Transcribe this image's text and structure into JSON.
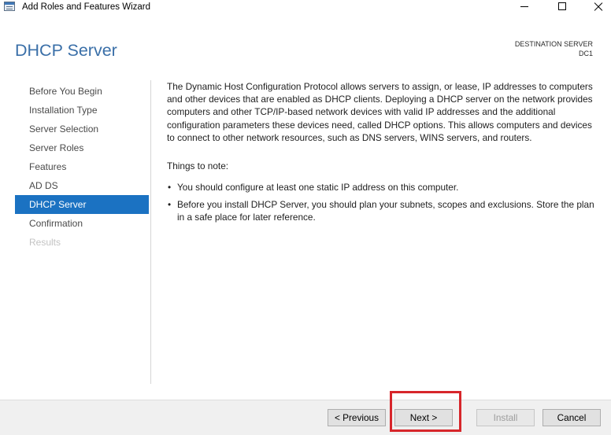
{
  "window": {
    "title": "Add Roles and Features Wizard",
    "app_icon": "server-manager-icon",
    "controls": {
      "minimize": "minimize-icon",
      "maximize": "maximize-icon",
      "close": "close-icon"
    }
  },
  "header": {
    "title": "DHCP Server",
    "destination_label": "DESTINATION SERVER",
    "destination_value": "DC1"
  },
  "nav": {
    "items": [
      {
        "label": "Before You Begin",
        "selected": false,
        "enabled": true
      },
      {
        "label": "Installation Type",
        "selected": false,
        "enabled": true
      },
      {
        "label": "Server Selection",
        "selected": false,
        "enabled": true
      },
      {
        "label": "Server Roles",
        "selected": false,
        "enabled": true
      },
      {
        "label": "Features",
        "selected": false,
        "enabled": true
      },
      {
        "label": "AD DS",
        "selected": false,
        "enabled": true
      },
      {
        "label": "DHCP Server",
        "selected": true,
        "enabled": true
      },
      {
        "label": "Confirmation",
        "selected": false,
        "enabled": true
      },
      {
        "label": "Results",
        "selected": false,
        "enabled": false
      }
    ]
  },
  "content": {
    "description_lines": [
      "The Dynamic Host Configuration Protocol allows servers to assign, or lease, IP addresses to computers",
      "and other devices that are enabled as DHCP clients. Deploying a DHCP server on the network provides",
      "computers and other TCP/IP-based network devices with valid IP addresses and the additional",
      "configuration parameters these devices need, called DHCP options. This allows computers and devices",
      "to connect to other network resources, such as DNS servers, WINS servers, and routers."
    ],
    "notes_heading": "Things to note:",
    "bullets": [
      {
        "lines": [
          "You should configure at least one static IP address on this computer."
        ]
      },
      {
        "lines": [
          "Before you install DHCP Server, you should plan your subnets, scopes and exclusions. Store the plan",
          "in a safe place for later reference."
        ]
      }
    ]
  },
  "footer": {
    "buttons": [
      {
        "label": "< Previous",
        "enabled": true
      },
      {
        "label": "Next >",
        "enabled": true
      },
      {
        "label": "Install",
        "enabled": false
      },
      {
        "label": "Cancel",
        "enabled": true
      }
    ]
  },
  "colors": {
    "heading": "#3a6fa8",
    "nav_selected_bg": "#1b72c2",
    "highlight": "#d7262b"
  }
}
